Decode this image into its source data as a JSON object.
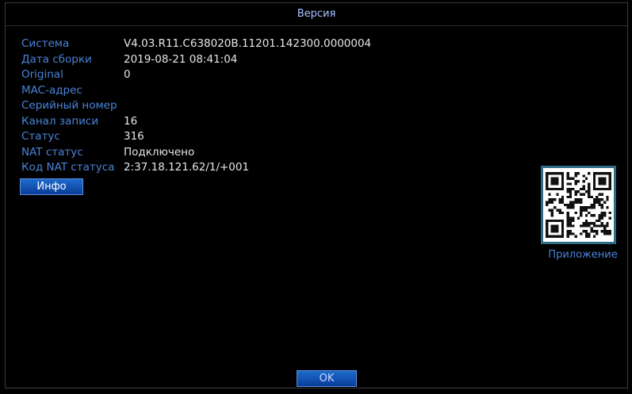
{
  "window": {
    "title": "Версия"
  },
  "info": [
    {
      "label": "Система",
      "value": "V4.03.R11.C638020B.11201.142300.0000004"
    },
    {
      "label": "Дата сборки",
      "value": "2019-08-21 08:41:04"
    },
    {
      "label": "Original",
      "value": "0"
    },
    {
      "label": "MAC-адрес",
      "value": ""
    },
    {
      "label": "Серийный номер",
      "value": ""
    },
    {
      "label": "Канал записи",
      "value": "16"
    },
    {
      "label": "Статус",
      "value": "316"
    },
    {
      "label": "NAT статус",
      "value": "Подключено"
    },
    {
      "label": "Код NAT статуса",
      "value": "2:37.18.121.62/1/+001"
    }
  ],
  "buttons": {
    "info": "Инфо",
    "ok": "OK"
  },
  "qr": {
    "label": "Приложение"
  },
  "colors": {
    "accent_label": "#4a83d8",
    "title": "#a9c2ff",
    "button": "#1e5fc0",
    "qr_border": "#2e6c86"
  }
}
